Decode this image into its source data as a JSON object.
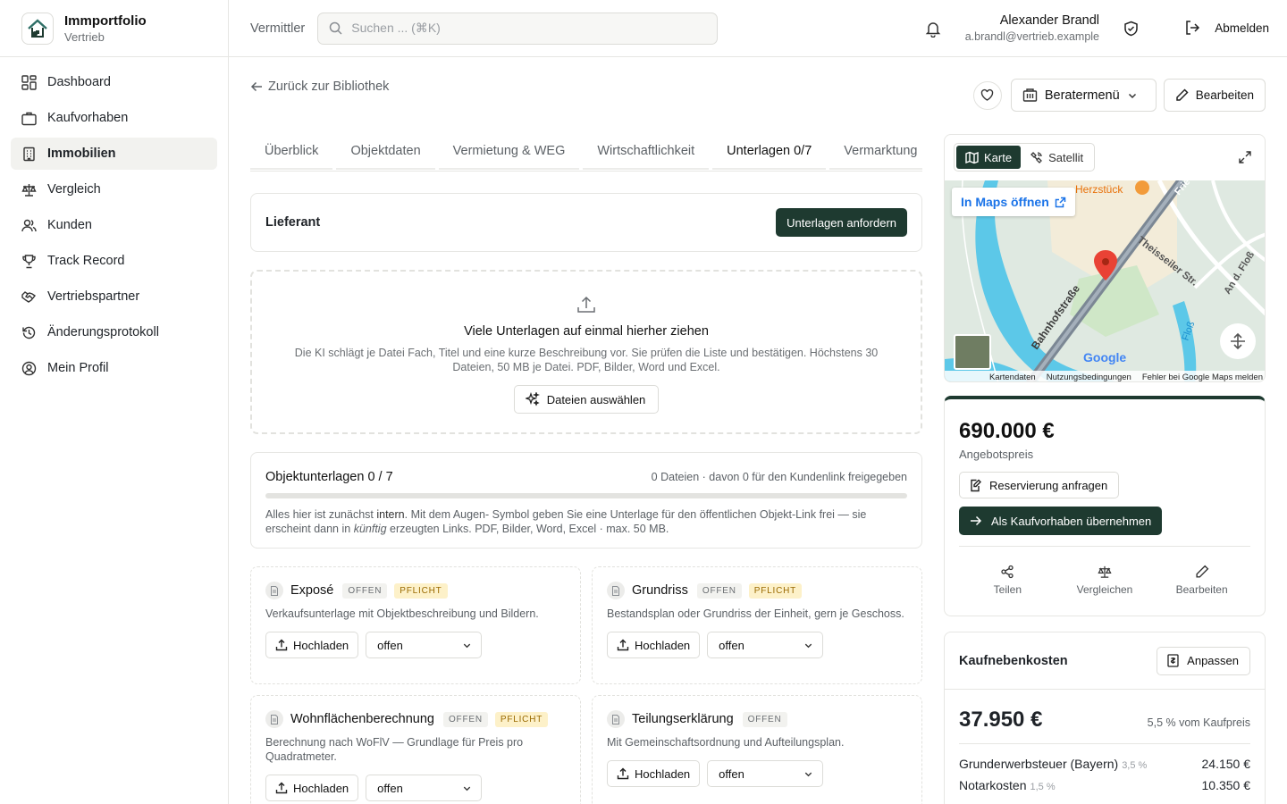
{
  "brand": {
    "name": "Immportfolio",
    "sub": "Vertrieb"
  },
  "nav": [
    {
      "label": "Dashboard",
      "icon": "dashboard-icon"
    },
    {
      "label": "Kaufvorhaben",
      "icon": "briefcase-icon"
    },
    {
      "label": "Immobilien",
      "icon": "building-icon",
      "active": true
    },
    {
      "label": "Vergleich",
      "icon": "scale-icon"
    },
    {
      "label": "Kunden",
      "icon": "users-icon"
    },
    {
      "label": "Track Record",
      "icon": "trophy-icon"
    },
    {
      "label": "Vertriebspartner",
      "icon": "handshake-icon"
    },
    {
      "label": "Änderungsprotokoll",
      "icon": "history-icon"
    },
    {
      "label": "Mein Profil",
      "icon": "user-circle-icon"
    }
  ],
  "topbar": {
    "crumb": "Vermittler",
    "search_placeholder": "Suchen ... (⌘K)",
    "user_name": "Alexander Brandl",
    "user_email": "a.brandl@vertrieb.example",
    "logout": "Abmelden"
  },
  "back": "Zurück zur Bibliothek",
  "actions": {
    "berater": "Beratermenü",
    "edit": "Bearbeiten"
  },
  "tabs": [
    "Überblick",
    "Objektdaten",
    "Vermietung & WEG",
    "Wirtschaftlichkeit",
    "Unterlagen 0/7",
    "Vermarktung"
  ],
  "lieferant": {
    "title": "Lieferant",
    "button": "Unterlagen anfordern"
  },
  "dropzone": {
    "title": "Viele Unterlagen auf einmal hierher ziehen",
    "text": "Die KI schlägt je Datei Fach, Titel und eine kurze Beschreibung vor. Sie prüfen die Liste und bestätigen. Höchstens 30 Dateien, 50 MB je Datei. PDF, Bilder, Word und Excel.",
    "button": "Dateien auswählen"
  },
  "objektunterlagen": {
    "title": "Objektunterlagen 0 / 7",
    "meta": "0 Dateien · davon 0 für den Kundenlink freigegeben",
    "progress": 0,
    "note_1": "Alles hier ist zunächst ",
    "note_intern": "intern",
    "note_2": ". Mit dem Augen- Symbol geben Sie eine Unterlage für den öffentlichen Objekt-Link frei — sie erscheint dann in ",
    "note_kuenftig": "künftig",
    "note_3": " erzeugten Links. PDF, Bilder, Word, Excel · max. 50 MB."
  },
  "docs": [
    {
      "title": "Exposé",
      "status": "OFFEN",
      "required": "PFLICHT",
      "desc": "Verkaufsunterlage mit Objektbeschreibung und Bildern.",
      "upload": "Hochladen",
      "select": "offen"
    },
    {
      "title": "Grundriss",
      "status": "OFFEN",
      "required": "PFLICHT",
      "desc": "Bestandsplan oder Grundriss der Einheit, gern je Geschoss.",
      "upload": "Hochladen",
      "select": "offen"
    },
    {
      "title": "Wohnflächenberechnung",
      "status": "OFFEN",
      "required": "PFLICHT",
      "desc": "Berechnung nach WoFlV — Grundlage für Preis pro Quadratmeter.",
      "upload": "Hochladen",
      "select": "offen"
    },
    {
      "title": "Teilungserklärung",
      "status": "OFFEN",
      "desc": "Mit Gemeinschaftsordnung und Aufteilungsplan.",
      "upload": "Hochladen",
      "select": "offen"
    }
  ],
  "map": {
    "tab_map": "Karte",
    "tab_sat": "Satellit",
    "open": "In Maps öffnen",
    "labels": {
      "poi": "Herzstück",
      "street1": "Bahnhofstraße",
      "street2": "Theisseiler Str.",
      "street3": "An d. Floß",
      "river": "Floß",
      "street4": "Frie"
    },
    "google": "Google",
    "footer": [
      "Kartendaten",
      "Nutzungsbedingungen",
      "Fehler bei Google Maps melden"
    ]
  },
  "price": {
    "value": "690.000 €",
    "label": "Angebotspreis",
    "reserve": "Reservierung anfragen",
    "adopt": "Als Kaufvorhaben übernehmen",
    "actions": [
      "Teilen",
      "Vergleichen",
      "Bearbeiten"
    ]
  },
  "costs": {
    "title": "Kaufnebenkosten",
    "button": "Anpassen",
    "total": "37.950 €",
    "pct": "5,5 % vom Kaufpreis",
    "rows": [
      {
        "label": "Grunderwerbsteuer (Bayern)",
        "rate": "3,5 %",
        "value": "24.150 €"
      },
      {
        "label": "Notarkosten",
        "rate": "1,5 %",
        "value": "10.350 €"
      }
    ]
  }
}
